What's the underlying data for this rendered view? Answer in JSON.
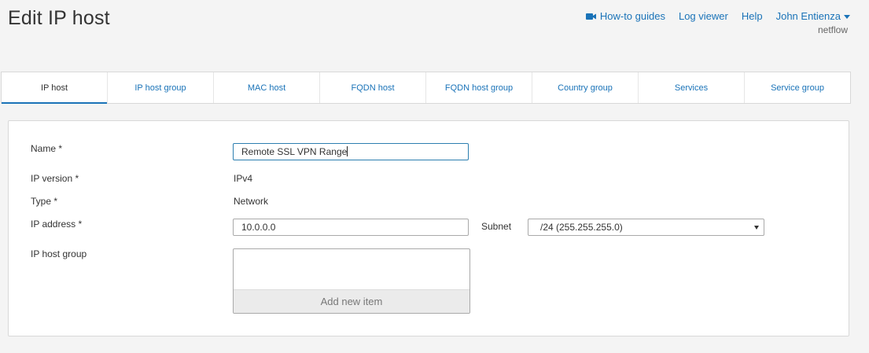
{
  "page": {
    "title": "Edit IP host"
  },
  "top_nav": {
    "howto_label": "How-to guides",
    "log_viewer_label": "Log viewer",
    "help_label": "Help",
    "user_name": "John Entienza",
    "tenant": "netflow"
  },
  "tabs": [
    {
      "label": "IP host",
      "active": true
    },
    {
      "label": "IP host group",
      "active": false
    },
    {
      "label": "MAC host",
      "active": false
    },
    {
      "label": "FQDN host",
      "active": false
    },
    {
      "label": "FQDN host group",
      "active": false
    },
    {
      "label": "Country group",
      "active": false
    },
    {
      "label": "Services",
      "active": false
    },
    {
      "label": "Service group",
      "active": false
    }
  ],
  "form": {
    "name_label": "Name *",
    "name_value": "Remote SSL VPN Range",
    "ip_version_label": "IP version *",
    "ip_version_value": "IPv4",
    "type_label": "Type *",
    "type_value": "Network",
    "ip_address_label": "IP address *",
    "ip_address_value": "10.0.0.0",
    "subnet_label": "Subnet",
    "subnet_value": "/24 (255.255.255.0)",
    "ip_host_group_label": "IP host group",
    "add_new_item_label": "Add new item"
  },
  "colors": {
    "accent": "#1a73b8",
    "background": "#f4f4f4",
    "focus_border": "#2d7fb0"
  }
}
